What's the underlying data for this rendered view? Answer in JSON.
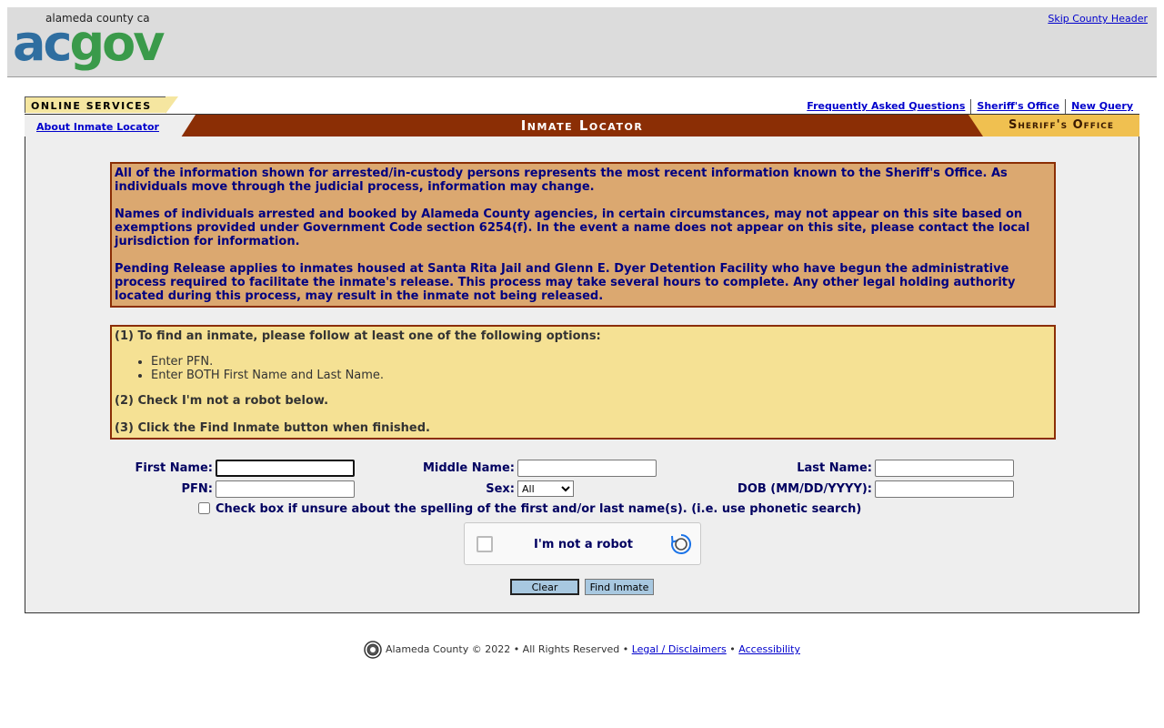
{
  "header": {
    "logo_small": "alameda county ca",
    "logo_ac": "ac",
    "logo_gov": "gov",
    "skip_link": "Skip County Header"
  },
  "nav": {
    "online_services": "ONLINE SERVICES",
    "about_link": "About Inmate Locator",
    "top_links": [
      "Frequently Asked Questions",
      "Sheriff's Office",
      "New Query"
    ]
  },
  "banner": {
    "title": "Inmate Locator",
    "sheriff": "Sheriff's Office"
  },
  "notice": {
    "p1": "All of the information shown for arrested/in-custody persons represents the most recent information known to the Sheriff's Office.  As individuals move through the judicial process, information may change.",
    "p2": "Names of individuals arrested and booked by Alameda County agencies, in certain circumstances, may not appear on this site based on exemptions provided under Government Code section 6254(f).  In the event a name does not appear on this site, please contact the local jurisdiction for information.",
    "p3": "Pending Release applies to inmates housed at Santa Rita Jail and Glenn E. Dyer Detention Facility who have begun the administrative process required to facilitate the inmate's release.  This process may take several hours to complete.  Any other legal holding authority located during this process, may result in the inmate not being released."
  },
  "instructions": {
    "step1": "(1) To find an inmate, please follow at least one of the following options:",
    "options": [
      "Enter PFN.",
      "Enter BOTH First Name and Last Name."
    ],
    "step2": "(2) Check I'm not a robot below.",
    "step3": "(3) Click the Find Inmate button when finished."
  },
  "form": {
    "first_name_label": "First Name:",
    "first_name_value": "",
    "middle_name_label": "Middle Name:",
    "middle_name_value": "",
    "last_name_label": "Last Name:",
    "last_name_value": "",
    "pfn_label": "PFN:",
    "pfn_value": "",
    "sex_label": "Sex:",
    "sex_selected": "All",
    "dob_label": "DOB (MM/DD/YYYY):",
    "dob_value": "",
    "phonetic_label": "Check box if unsure about the spelling of the first and/or last name(s). (i.e. use phonetic search)",
    "captcha_label": "I'm not a robot",
    "clear_button": "Clear",
    "find_button": "Find Inmate"
  },
  "footer": {
    "copyright": "Alameda County © 2022 • All Rights Reserved •",
    "legal_link": "Legal / Disclaimers",
    "bullet": "•",
    "accessibility_link": "Accessibility"
  },
  "colors": {
    "banner_brown": "#8b2e05",
    "notice_bg": "#dba870",
    "instructions_bg": "#f5e194",
    "sheriff_gold": "#f0c050",
    "logo_blue": "#2f6ea0",
    "logo_green": "#3a9a4a"
  }
}
